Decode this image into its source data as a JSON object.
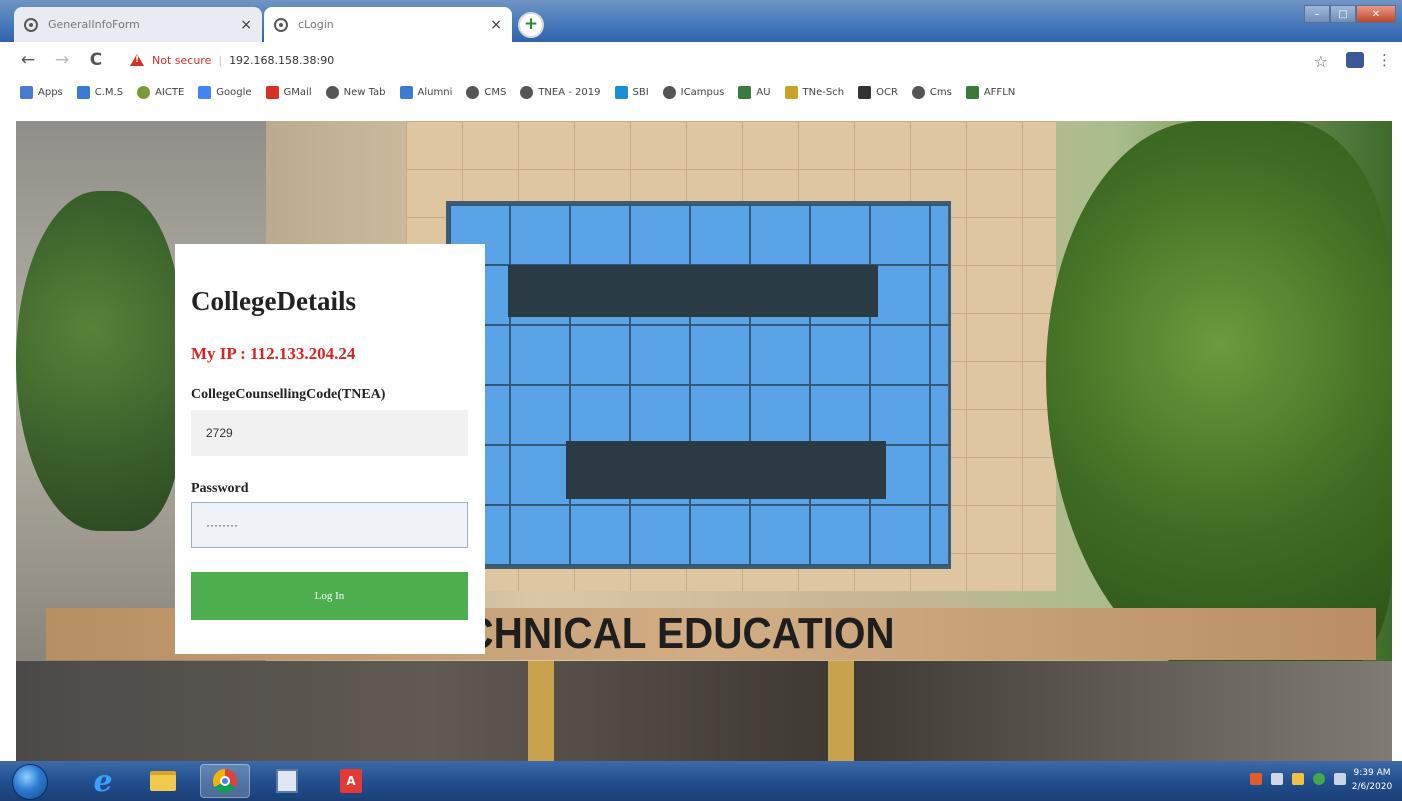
{
  "browser": {
    "tabs": [
      {
        "title": "GeneralInfoForm",
        "close": "×",
        "active": false
      },
      {
        "title": "cLogin",
        "close": "×",
        "active": true
      }
    ],
    "new_tab": "+",
    "nav": {
      "back": "←",
      "forward": "→",
      "reload": "C"
    },
    "address": {
      "security": "Not secure",
      "separator": "|",
      "url": "192.168.158.38:90"
    },
    "star": "☆",
    "menu": "⋮",
    "bookmarks": [
      {
        "label": "Apps",
        "icon": "apps-grid-icon",
        "color": "#4a7bd0"
      },
      {
        "label": "C.M.S",
        "icon": "page-icon",
        "color": "#3b7bd6"
      },
      {
        "label": "AICTE",
        "icon": "globe-icon",
        "color": "#7a9a3a"
      },
      {
        "label": "Google",
        "icon": "google-icon",
        "color": "#4285f4"
      },
      {
        "label": "GMail",
        "icon": "gmail-icon",
        "color": "#d93025"
      },
      {
        "label": "New Tab",
        "icon": "globe-icon",
        "color": "#555555"
      },
      {
        "label": "Alumni",
        "icon": "page-icon",
        "color": "#3b7bd6"
      },
      {
        "label": "CMS",
        "icon": "globe-icon",
        "color": "#555555"
      },
      {
        "label": "TNEA - 2019",
        "icon": "globe-icon",
        "color": "#555555"
      },
      {
        "label": "SBI",
        "icon": "sbi-icon",
        "color": "#1a8fd8"
      },
      {
        "label": "ICampus",
        "icon": "globe-icon",
        "color": "#555555"
      },
      {
        "label": "AU",
        "icon": "au-icon",
        "color": "#3a7a3a"
      },
      {
        "label": "TNe-Sch",
        "icon": "emblem-icon",
        "color": "#c9a227"
      },
      {
        "label": "OCR",
        "icon": "ocr-icon",
        "color": "#333333"
      },
      {
        "label": "Cms",
        "icon": "globe-icon",
        "color": "#555555"
      },
      {
        "label": "AFFLN",
        "icon": "au-icon",
        "color": "#3a7a3a"
      }
    ]
  },
  "page": {
    "sign": "ATE OF TECHNICAL EDUCATION"
  },
  "login": {
    "title": "CollegeDetails",
    "ip": "My IP : 112.133.204.24",
    "code_label": "CollegeCounsellingCode(TNEA)",
    "code_value": "2729",
    "password_label": "Password",
    "password_value": "········",
    "button": "Log In"
  },
  "taskbar": {
    "pdf_label": "A",
    "clock_time": "9:39 AM",
    "clock_date": "2/6/2020"
  }
}
